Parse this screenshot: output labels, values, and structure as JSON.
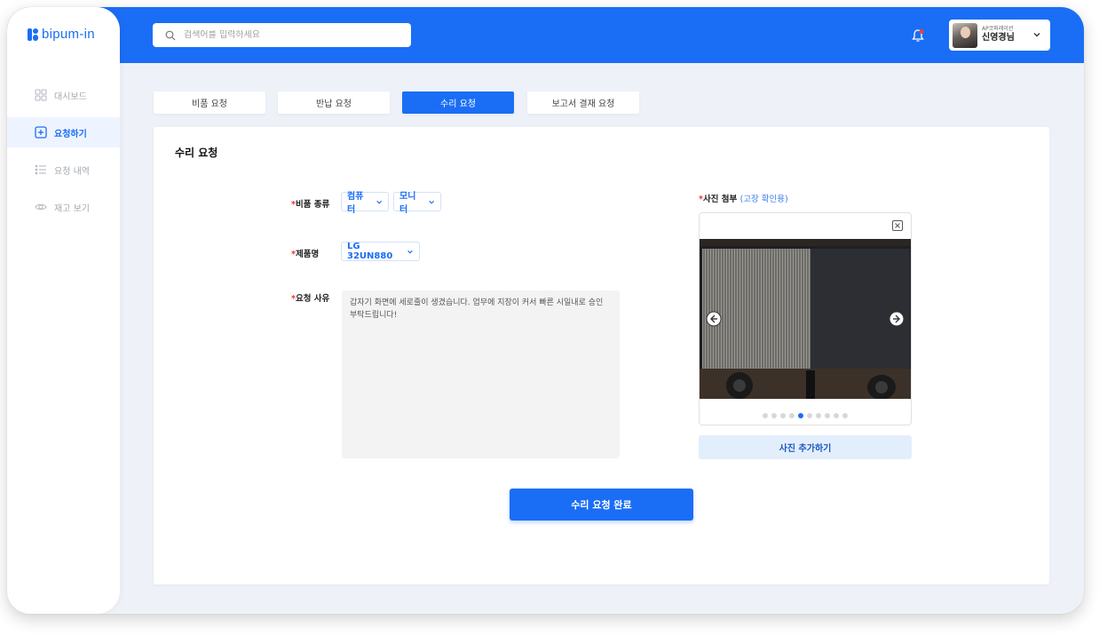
{
  "app": {
    "logo_text": "bipum-in"
  },
  "search": {
    "placeholder": "검색어를 입력하세요"
  },
  "user": {
    "company": "AP코퍼레이션",
    "name": "신영경님"
  },
  "sidebar": {
    "items": [
      {
        "label": "대시보드",
        "icon": "dashboard-grid-icon"
      },
      {
        "label": "요청하기",
        "icon": "plus-square-icon",
        "active": true
      },
      {
        "label": "요청 내역",
        "icon": "list-icon"
      },
      {
        "label": "재고 보기",
        "icon": "eye-icon"
      }
    ]
  },
  "tabs": [
    {
      "label": "비품 요청"
    },
    {
      "label": "반납 요청"
    },
    {
      "label": "수리 요청",
      "active": true
    },
    {
      "label": "보고서 결재 요청"
    }
  ],
  "form": {
    "title": "수리 요청",
    "required_mark": "*",
    "category_label": "비품 종류",
    "category_value": "컴퓨터",
    "subcategory_value": "모니터",
    "product_label": "제품명",
    "product_value": "LG 32UN880",
    "reason_label": "요청 사유",
    "reason_value": "갑자기 화면에 세로줄이 생겼습니다. 업무에 지장이 커서 빠른 시일내로 승인 부탁드립니다!",
    "photo_label": "사진 첨부",
    "photo_hint": "(고장 확인용)",
    "photo_pages": 10,
    "photo_current": 5,
    "add_photo_label": "사진 추가하기",
    "submit_label": "수리 요청 완료"
  },
  "colors": {
    "primary": "#1a6ef5",
    "required": "#e53935",
    "background": "#eef2f8"
  }
}
